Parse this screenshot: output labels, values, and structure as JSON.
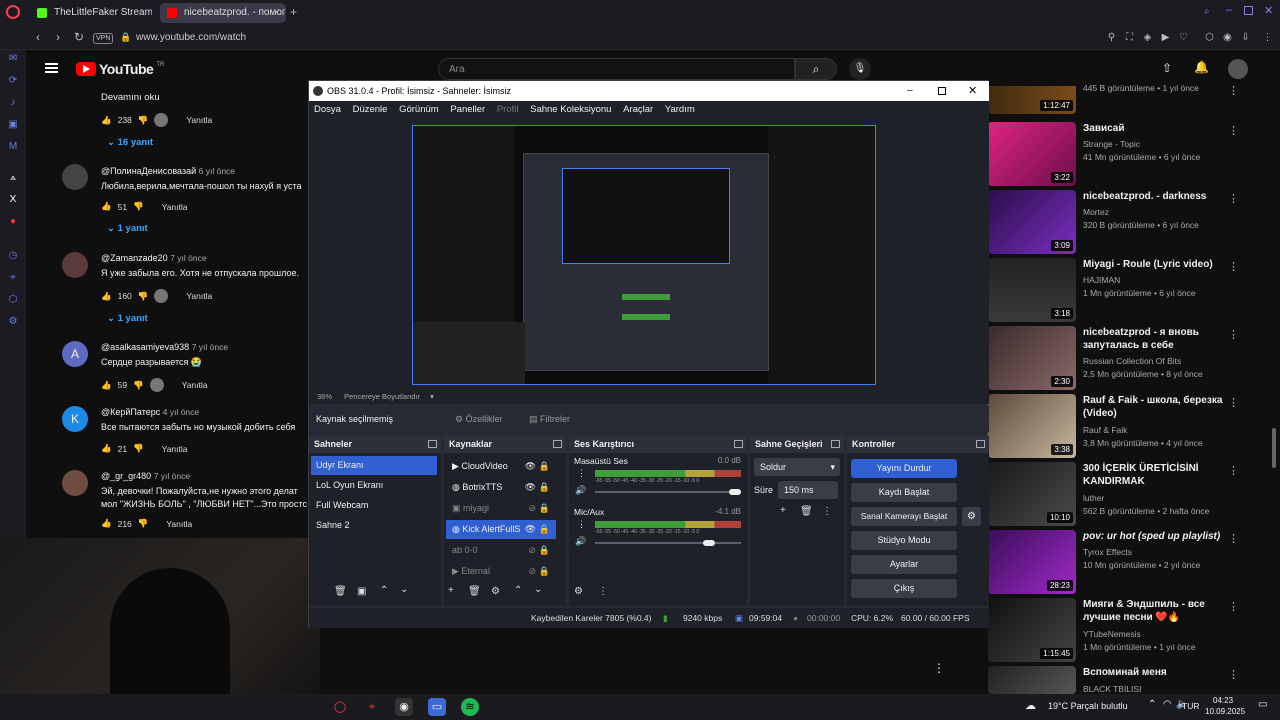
{
  "browser": {
    "tabs": [
      {
        "title": "TheLittleFaker Stream - W",
        "active": false
      },
      {
        "title": "nicebeatzprod. - помоги",
        "active": true
      }
    ],
    "vpn_label": "VPN",
    "url": "www.youtube.com/watch"
  },
  "youtube": {
    "logo_text": "YouTube",
    "region": "TR",
    "search_placeholder": "Ara",
    "read_more": "Devamını oku",
    "comments": [
      {
        "likes": "238",
        "reply_label": "Yanıtla",
        "replies": "16 yanıt"
      },
      {
        "author": "@ПолинаДенисовазай",
        "age": "6 yıl önce",
        "text": "Любила,верила,мечтала-пошол ты нахуй я уста",
        "likes": "51",
        "reply_label": "Yanıtla",
        "replies": "1 yanıt"
      },
      {
        "author": "@Zamanzade20",
        "age": "7 yıl önce",
        "text": "Я уже забыла его. Хотя не отпускала прошлое.",
        "likes": "160",
        "reply_label": "Yanıtla",
        "replies": "1 yanıt"
      },
      {
        "author": "@asalkasamiyeva938",
        "age": "7 yıl önce",
        "text": "Сердце разрывается 😭",
        "likes": "59",
        "reply_label": "Yanıtla",
        "initial": "A"
      },
      {
        "author": "@КерйПатерс",
        "age": "4 yıl önce",
        "text": "Все пытаются забыть но музыкой добить себя",
        "likes": "21",
        "reply_label": "Yanıtla",
        "initial": "K"
      },
      {
        "author": "@_gr_gr480",
        "age": "7 yıl önce",
        "text": "Эй, девочки! Пожалуйста,не нужно этого делат",
        "text2": "мол \"ЖИЗНЬ БОЛЬ\" , \"ЛЮБВИ НЕТ\"...Это простс",
        "likes": "216",
        "reply_label": "Yanıtla"
      }
    ],
    "recommendations": [
      {
        "title": "",
        "channel": "",
        "views": "445 B görüntüleme • 1 yıl önce",
        "duration": "1:12:47"
      },
      {
        "title": "Зависай",
        "channel": "Strange - Topic",
        "views": "41 Mn görüntüleme • 6 yıl önce",
        "duration": "3:22"
      },
      {
        "title": "nicebeatzprod. - darkness",
        "channel": "Mortez",
        "views": "320 B görüntüleme • 6 yıl önce",
        "duration": "3:09"
      },
      {
        "title": "Miyagi - Roule (Lyric video)",
        "channel": "HAJIMAN",
        "views": "1 Mn görüntüleme • 6 yıl önce",
        "duration": "3:18"
      },
      {
        "title": "nicebeatzprod - я вновь запуталась в себе",
        "channel": "Russian Collection Of Bits",
        "views": "2,5 Mn görüntüleme • 8 yıl önce",
        "duration": "2:30"
      },
      {
        "title": "Rauf & Faik - школа, березка (Video)",
        "channel": "Rauf & Faik",
        "views": "3,8 Mn görüntüleme • 4 yıl önce",
        "duration": "3:38"
      },
      {
        "title": "300 İÇERİK ÜRETİCİSİNİ KANDIRMAK",
        "channel": "luther",
        "views": "562 B görüntüleme • 2 hafta önce",
        "duration": "10:10"
      },
      {
        "title": "pov: ur hot (sped up playlist)",
        "channel": "Tyrox Effects",
        "views": "10 Mn görüntüleme • 2 yıl önce",
        "duration": "28:23"
      },
      {
        "title": "Мияги & Эндшпиль - все лучшие песни ❤️🔥",
        "channel": "YTubeNemesis",
        "views": "1 Mn görüntüleme • 1 yıl önce",
        "duration": "1:15:45"
      },
      {
        "title": "Вспоминай меня",
        "channel": "BLACK TBILISI",
        "views": "",
        "duration": ""
      }
    ]
  },
  "obs": {
    "title": "OBS 31.0.4 - Profil: İsimsiz - Sahneler: İsimsiz",
    "menu": [
      "Dosya",
      "Düzenle",
      "Görünüm",
      "Paneller",
      "Profil",
      "Sahne Koleksiyonu",
      "Araçlar",
      "Yardım"
    ],
    "zoom": "36%",
    "zoom_mode": "Pencereye Boyutlandır",
    "no_source": "Kaynak seçilmemiş",
    "properties_label": "Özellikler",
    "filters_label": "Filtreler",
    "panels": {
      "scenes": "Sahneler",
      "sources": "Kaynaklar",
      "mixer": "Ses Karıştırıcı",
      "transitions": "Sahne Geçişleri",
      "controls": "Kontroller"
    },
    "scenes": [
      "Udyr Ekranı",
      "LoL Oyun Ekranı",
      "Full Webcam",
      "Sahne 2"
    ],
    "sources": [
      "CloudVideo",
      "BotrixTTS",
      "miyagi",
      "Kick AlertFullS",
      "0-0",
      "Eternal"
    ],
    "mixer": [
      {
        "name": "Masaüstü Ses",
        "db": "0.0 dB",
        "level": 0.88
      },
      {
        "name": "Mic/Aux",
        "db": "-4.1 dB",
        "level": 0.78
      }
    ],
    "meter_ticks": "-65 -55 -50 -45 -40 -35 -30 -25 -20 -15 -10 -5 0",
    "transition": "Soldur",
    "duration_label": "Süre",
    "duration_value": "150 ms",
    "controls": [
      "Yayını Durdur",
      "Kaydı Başlat",
      "Sanal Kamerayı Başlat",
      "Stüdyo Modu",
      "Ayarlar",
      "Çıkış"
    ],
    "status": {
      "dropped": "Kaybedilen Kareler 7805 (%0.4)",
      "bitrate": "9240 kbps",
      "live_time": "09:59:04",
      "rec_time": "00:00:00",
      "cpu": "CPU: 6.2%",
      "fps": "60.00 / 60.00 FPS"
    }
  },
  "taskbar": {
    "weather": "19°C  Parçalı bulutlu",
    "lang": "TUR",
    "time": "04:23",
    "date": "10.09.2025"
  }
}
